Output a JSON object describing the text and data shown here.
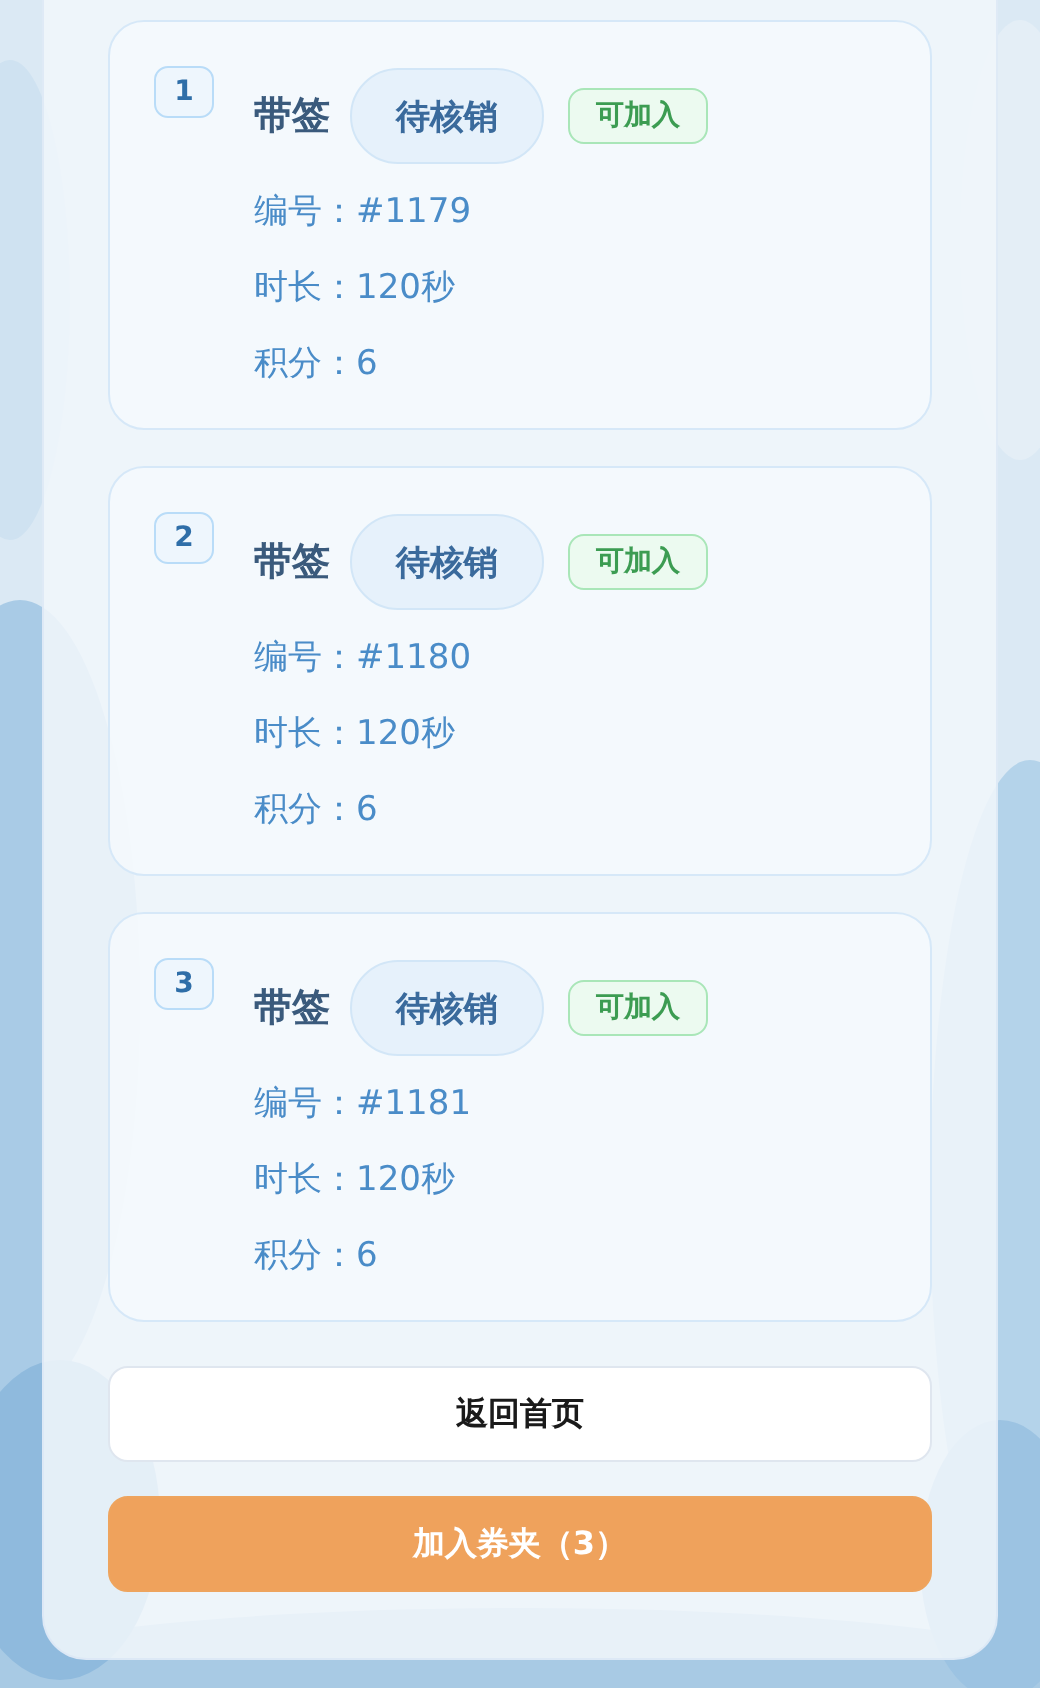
{
  "cards": [
    {
      "index": "1",
      "title": "带签",
      "status": "待核销",
      "tag": "可加入",
      "fields": [
        {
          "label": "编号：",
          "value": "#1179"
        },
        {
          "label": "时长：",
          "value": "120秒"
        },
        {
          "label": "积分：",
          "value": "6"
        }
      ]
    },
    {
      "index": "2",
      "title": "带签",
      "status": "待核销",
      "tag": "可加入",
      "fields": [
        {
          "label": "编号：",
          "value": "#1180"
        },
        {
          "label": "时长：",
          "value": "120秒"
        },
        {
          "label": "积分：",
          "value": "6"
        }
      ]
    },
    {
      "index": "3",
      "title": "带签",
      "status": "待核销",
      "tag": "可加入",
      "fields": [
        {
          "label": "编号：",
          "value": "#1181"
        },
        {
          "label": "时长：",
          "value": "120秒"
        },
        {
          "label": "积分：",
          "value": "6"
        }
      ]
    }
  ],
  "buttons": [
    {
      "label": "返回首页",
      "kind": "secondary"
    },
    {
      "label": "加入券夹（3）",
      "kind": "primary"
    }
  ]
}
